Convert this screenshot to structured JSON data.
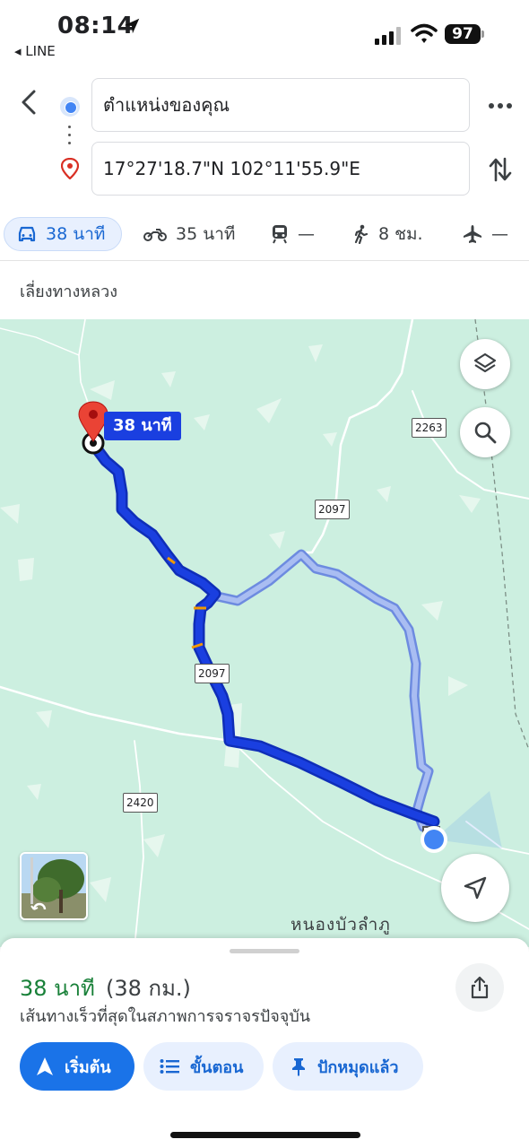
{
  "status_bar": {
    "time": "08:14",
    "back_app": "◂ LINE",
    "battery": "97"
  },
  "directions": {
    "origin": "ตำแหน่งของคุณ",
    "destination": "17°27'18.7\"N 102°11'55.9\"E",
    "modes": [
      {
        "icon": "car-icon",
        "label": "38 นาที",
        "active": true
      },
      {
        "icon": "motorcycle-icon",
        "label": "35 นาที",
        "active": false
      },
      {
        "icon": "train-icon",
        "label": "—",
        "active": false
      },
      {
        "icon": "walk-icon",
        "label": "8 ชม.",
        "active": false
      },
      {
        "icon": "plane-icon",
        "label": "—",
        "active": false
      }
    ],
    "options": "เลี่ยงทางหลวง"
  },
  "map": {
    "eta_chip": "38 นาที",
    "road_shields": [
      "2263",
      "2097",
      "2097",
      "2420"
    ],
    "place_label": "หนองบัวลำภู",
    "colors": {
      "land": "#ccefe0",
      "route_primary": "#1a3fe0",
      "route_alternate": "#9bb3f0",
      "road": "#ffffff",
      "pin": "#ea4335",
      "location_dot": "#4285f4"
    }
  },
  "sheet": {
    "duration": "38 นาที",
    "distance": "(38 กม.)",
    "description": "เส้นทางเร็วที่สุดในสภาพการจราจรปัจจุบัน",
    "start_label": "เริ่มต้น",
    "steps_label": "ขั้นตอน",
    "pinned_label": "ปักหมุดแล้ว"
  }
}
